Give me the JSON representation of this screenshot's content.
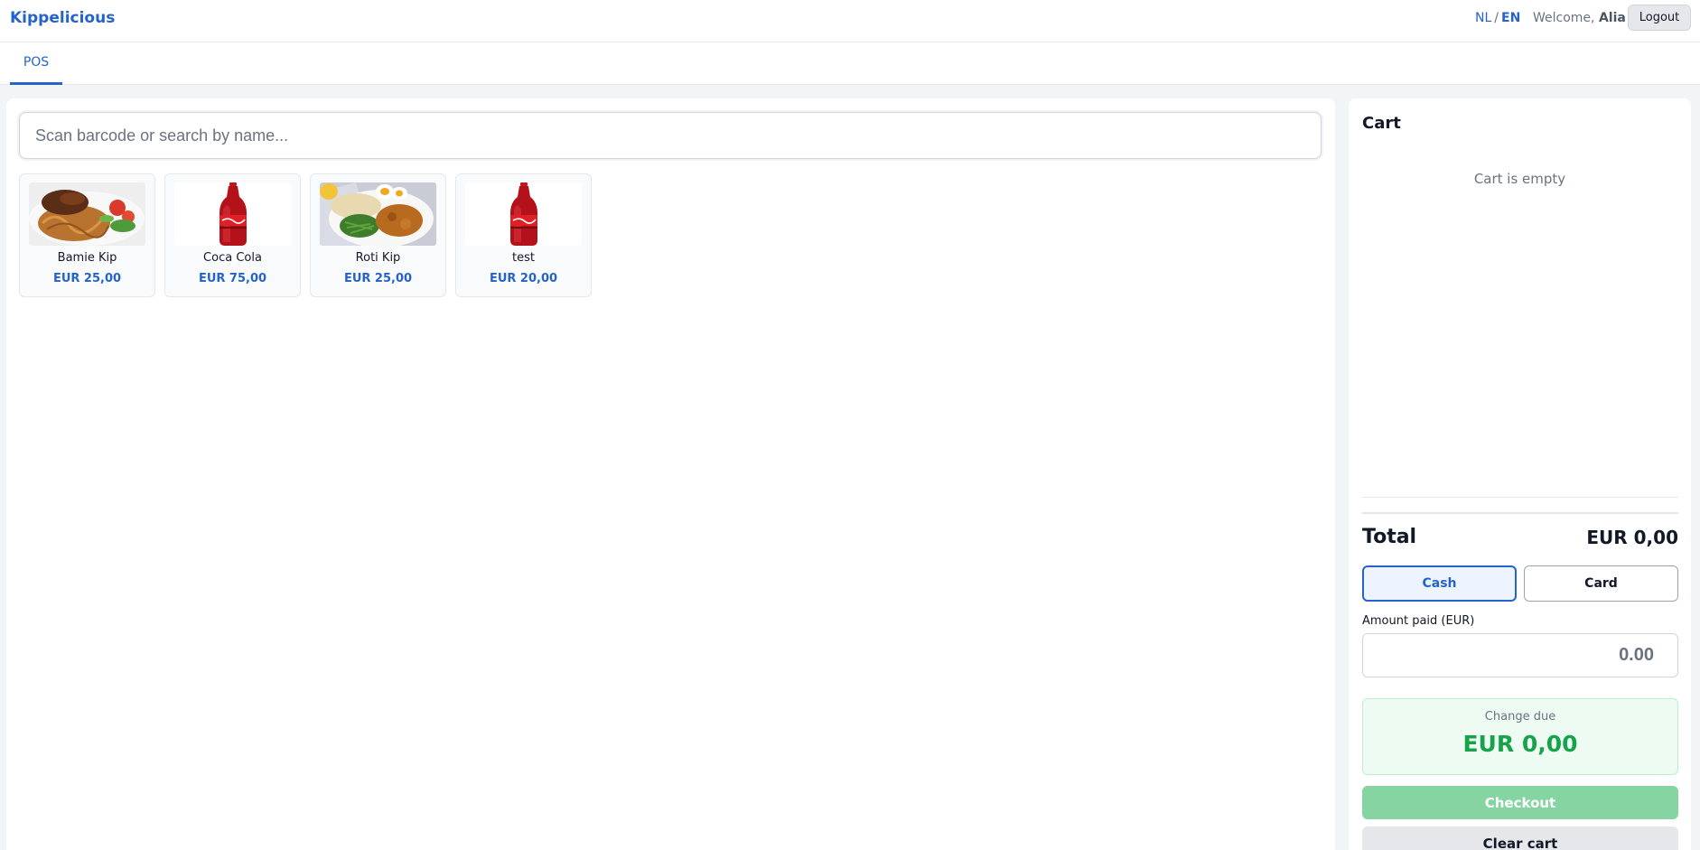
{
  "header": {
    "brand": "Kippelicious",
    "lang_nl": "NL",
    "lang_sep": "/",
    "lang_en": "EN",
    "welcome_prefix": "Welcome,",
    "user_name": "Alia",
    "logout_label": "Logout"
  },
  "tabs": [
    {
      "label": "POS",
      "active": true
    }
  ],
  "search": {
    "placeholder": "Scan barcode or search by name..."
  },
  "products": [
    {
      "name": "Bamie Kip",
      "price": "EUR 25,00",
      "image": "noodles-chicken-photo"
    },
    {
      "name": "Coca Cola",
      "price": "EUR 75,00",
      "image": "cola-bottle-photo"
    },
    {
      "name": "Roti Kip",
      "price": "EUR 25,00",
      "image": "roti-curry-photo"
    },
    {
      "name": "test",
      "price": "EUR 20,00",
      "image": "cola-bottle-photo"
    }
  ],
  "cart": {
    "title": "Cart",
    "empty_text": "Cart is empty",
    "total_label": "Total",
    "total_value": "EUR 0,00",
    "pay_cash_label": "Cash",
    "pay_card_label": "Card",
    "selected_method": "Cash",
    "amount_label": "Amount paid (EUR)",
    "amount_placeholder": "0.00",
    "change_label": "Change due",
    "change_value": "EUR 0,00",
    "checkout_label": "Checkout",
    "clear_label": "Clear cart"
  },
  "colors": {
    "accent": "#2563c9",
    "success": "#16a34a",
    "checkout_disabled": "#86d4a2"
  }
}
